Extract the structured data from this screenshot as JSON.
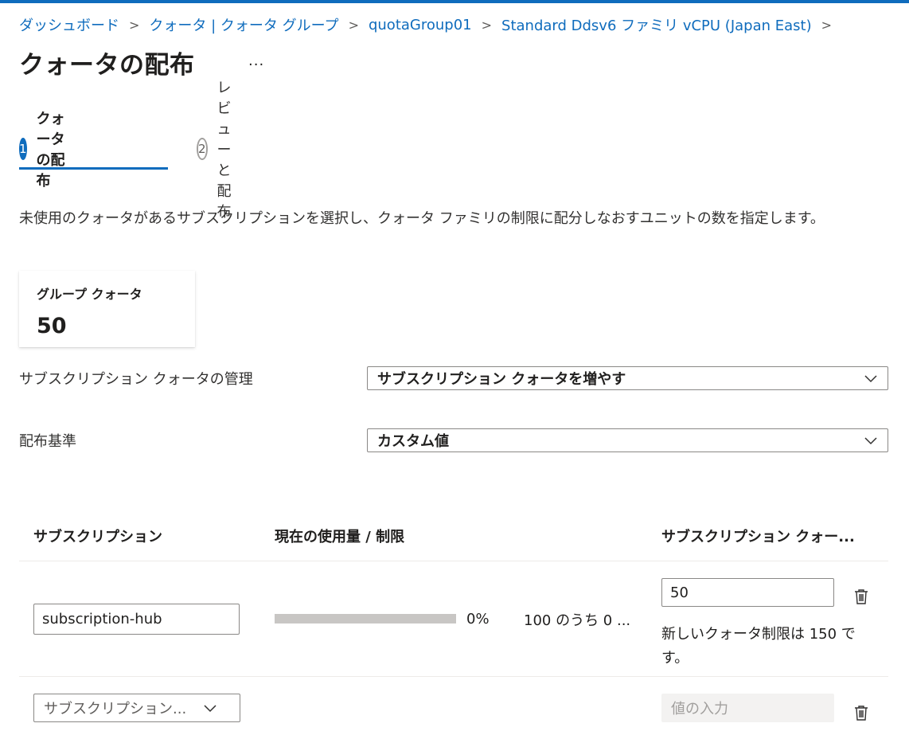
{
  "breadcrumb": {
    "items": [
      "ダッシュボード",
      "クォータ | クォータ グループ",
      "quotaGroup01",
      "Standard Ddsv6 ファミリ vCPU (Japan East)"
    ]
  },
  "page": {
    "title": "クォータの配布",
    "more_label": "..."
  },
  "steps": [
    {
      "number": "1",
      "label": "クォータの配布",
      "active": true
    },
    {
      "number": "2",
      "label": "レビューと配布",
      "active": false
    }
  ],
  "description": "未使用のクォータがあるサブスクリプションを選択し、クォータ ファミリの制限に配分しなおすユニットの数を指定します。",
  "group_quota": {
    "label": "グループ クォータ",
    "value": "50"
  },
  "form": {
    "manage_label": "サブスクリプション クォータの管理",
    "manage_value": "サブスクリプション クォータを増やす",
    "basis_label": "配布基準",
    "basis_value": "カスタム値"
  },
  "table": {
    "headers": [
      "サブスクリプション",
      "現在の使用量 / 制限",
      "サブスクリプション クォー..."
    ],
    "rows": [
      {
        "subscription": "subscription-hub",
        "usage_percent": 0,
        "usage_percent_label": "0%",
        "usage_text": "100 のうち 0 ...",
        "quota_value": "50",
        "new_limit_text": "新しいクォータ制限は 150 です。"
      }
    ],
    "new_row": {
      "subscription_placeholder": "サブスクリプション...",
      "value_placeholder": "値の入力"
    }
  },
  "colors": {
    "accent": "#0f6cbd",
    "progress_track": "#c8c6c4",
    "disabled_bg": "#f3f2f1"
  }
}
